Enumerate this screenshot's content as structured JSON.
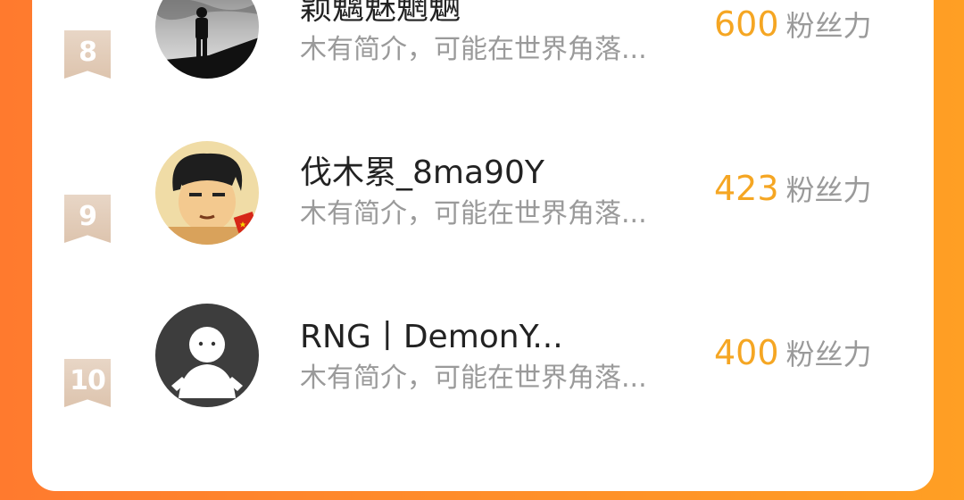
{
  "users": [
    {
      "rank": "8",
      "name": "颖魑魅魍魉",
      "bio": "木有简介，可能在世界角落...",
      "fans_count": "600",
      "fans_unit": "粉丝力",
      "avatar_icon": "silhouette-avatar"
    },
    {
      "rank": "9",
      "name": "伐木累_8ma90Y",
      "bio": "木有简介，可能在世界角落...",
      "fans_count": "423",
      "fans_unit": "粉丝力",
      "avatar_icon": "cartoon-avatar"
    },
    {
      "rank": "10",
      "name": "RNG丨DemonY...",
      "bio": "木有简介，可能在世界角落...",
      "fans_count": "400",
      "fans_unit": "粉丝力",
      "avatar_icon": "default-avatar"
    }
  ],
  "colors": {
    "accent": "#f5a623",
    "rank_badge": "#e2cbb6",
    "background_gradient_start": "#ff7a2e",
    "background_gradient_end": "#ff9f24"
  }
}
